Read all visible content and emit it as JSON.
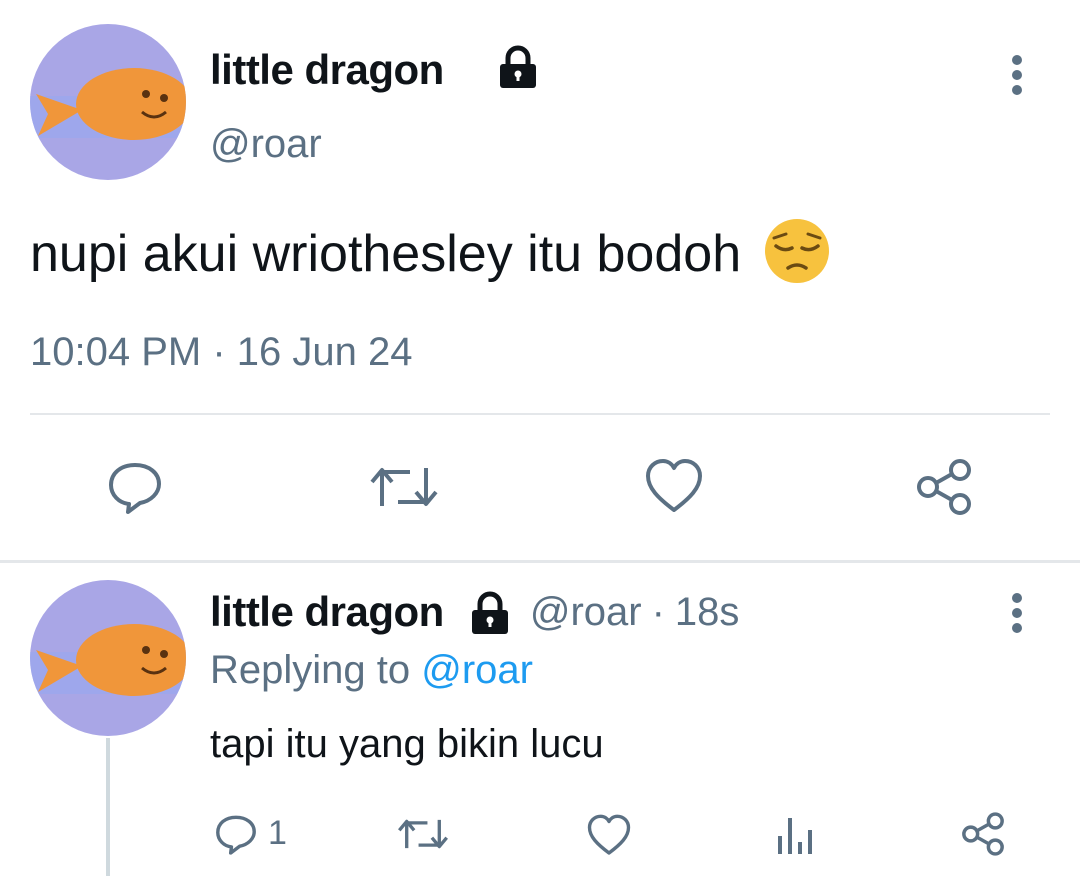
{
  "main_tweet": {
    "author_name": "little dragon",
    "author_handle": "@roar",
    "text": "nupi akui wriothesley itu bodoh",
    "emoji": "😔",
    "timestamp": "10:04 PM · 16 Jun 24"
  },
  "reply_tweet": {
    "author_name": "little dragon",
    "author_handle": "@roar",
    "time_ago": "18s",
    "replying_prefix": "Replying to",
    "replying_to": "@roar",
    "text": "tapi itu yang bikin lucu",
    "reply_count": "1"
  },
  "colors": {
    "text_primary": "#0f1419",
    "text_secondary": "#5b7083",
    "link": "#1d9bf0",
    "avatar_bg": "#a9a6e6",
    "fish": "#f0963a"
  },
  "icons": [
    "lock-icon",
    "more-icon",
    "reply-icon",
    "retweet-icon",
    "like-icon",
    "share-icon",
    "analytics-icon"
  ]
}
